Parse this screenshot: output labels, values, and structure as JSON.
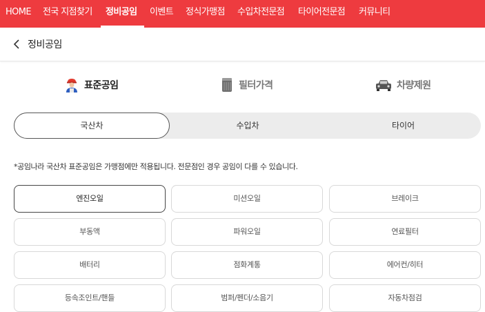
{
  "topnav": {
    "items": [
      "HOME",
      "전국 지점찾기",
      "정비공임",
      "이벤트",
      "정식가맹점",
      "수입차전문점",
      "타이어전문점",
      "커뮤니티"
    ],
    "active": "정비공임"
  },
  "header": {
    "title": "정비공임"
  },
  "categories": [
    {
      "label": "표준공임",
      "icon": "mechanic-icon",
      "active": true
    },
    {
      "label": "필터가격",
      "icon": "filter-icon",
      "active": false
    },
    {
      "label": "차량제원",
      "icon": "car-icon",
      "active": false
    }
  ],
  "tabs": [
    {
      "label": "국산차",
      "active": true
    },
    {
      "label": "수입차",
      "active": false
    },
    {
      "label": "타이어",
      "active": false
    }
  ],
  "notice": "*공임나라 국산차 표준공임은 가맹점에만 적용됩니다. 전문점인 경우 공임이 다를 수 있습니다.",
  "items": [
    "엔진오일",
    "미션오일",
    "브레이크",
    "부동액",
    "파워오일",
    "연료필터",
    "배터리",
    "점화계통",
    "에어컨/히터",
    "등속조인트/핸들",
    "범퍼/펜더/소음기",
    "자동차점검"
  ],
  "colors": {
    "brand": "#ee3b3f"
  }
}
